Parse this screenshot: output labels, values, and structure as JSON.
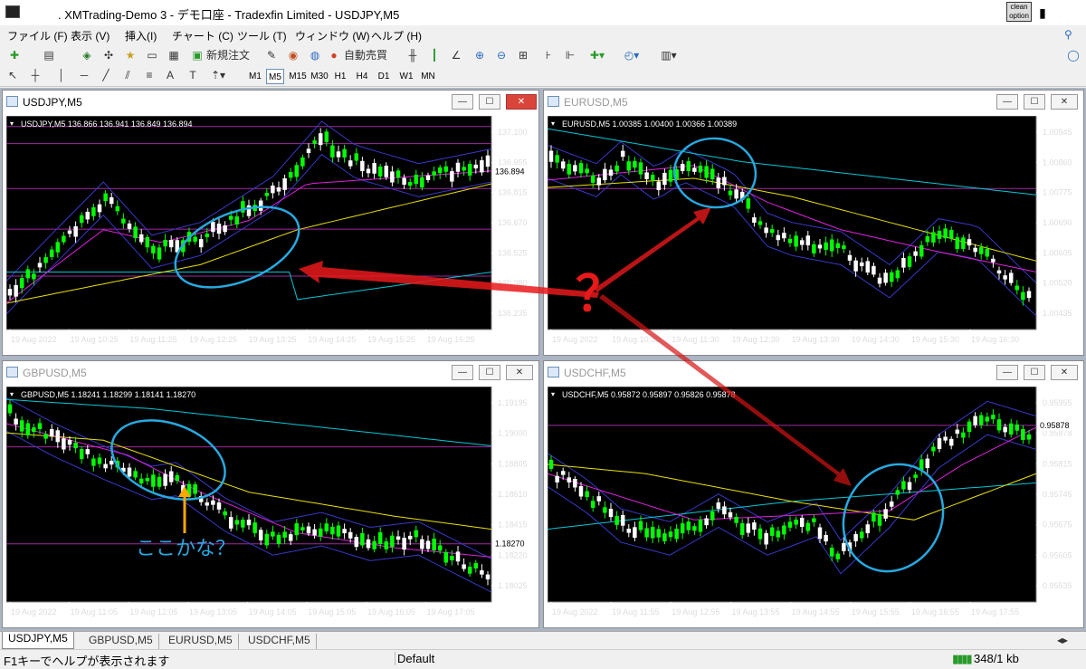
{
  "app": {
    "title": ". XMTrading-Demo 3 - デモ口座 - Tradexfin Limited - USDJPY,M5",
    "clean_top": "clean",
    "clean_bottom": "option"
  },
  "menu": [
    "ファイル (F)",
    "表示 (V)",
    "挿入(I)",
    "チャート (C)",
    "ツール (T)",
    "ウィンドウ (W)",
    "ヘルプ (H)"
  ],
  "toolbar": {
    "new_order": "新規注文",
    "auto_trade": "自動売買"
  },
  "timeframes": [
    "M1",
    "M5",
    "M15",
    "M30",
    "H1",
    "H4",
    "D1",
    "W1",
    "MN"
  ],
  "active_timeframe": "M5",
  "charts": [
    {
      "id": "usdjpy",
      "caption": "USDJPY,M5",
      "info": "USDJPY,M5  136.866 136.941 136.849 136.894",
      "prices": [
        "137.100",
        "136.955",
        "136.815",
        "136.670",
        "136.525",
        "136.380",
        "136.235"
      ],
      "current_price": "136.894",
      "times": [
        "19 Aug 2022",
        "19 Aug 10:25",
        "19 Aug 11:25",
        "19 Aug 12:25",
        "19 Aug 13:25",
        "19 Aug 14:25",
        "19 Aug 15:25",
        "19 Aug 16:25"
      ]
    },
    {
      "id": "eurusd",
      "caption": "EURUSD,M5",
      "info": "EURUSD,M5  1.00385 1.00400 1.00366 1.00389",
      "prices": [
        "1.00945",
        "1.00860",
        "1.00775",
        "1.00690",
        "1.00605",
        "1.00520",
        "1.00435"
      ],
      "current_price": "",
      "times": [
        "19 Aug 2022",
        "19 Aug 10:30",
        "19 Aug 11:30",
        "19 Aug 12:30",
        "19 Aug 13:30",
        "19 Aug 14:30",
        "19 Aug 15:30",
        "19 Aug 16:30"
      ]
    },
    {
      "id": "gbpusd",
      "caption": "GBPUSD,M5",
      "info": "GBPUSD,M5  1.18241 1.18299 1.18141 1.18270",
      "prices": [
        "1.19195",
        "1.19000",
        "1.18805",
        "1.18610",
        "1.18415",
        "1.18220",
        "1.18025"
      ],
      "current_price": "1.18270",
      "times": [
        "19 Aug 2022",
        "19 Aug 11:05",
        "19 Aug 12:05",
        "19 Aug 13:05",
        "19 Aug 14:05",
        "19 Aug 15:05",
        "19 Aug 16:05",
        "19 Aug 17:05"
      ]
    },
    {
      "id": "usdchf",
      "caption": "USDCHF,M5",
      "info": "USDCHF,M5  0.95872 0.95897 0.95826 0.95878",
      "prices": [
        "0.95955",
        "0.95878",
        "0.95815",
        "0.95745",
        "0.95675",
        "0.95605",
        "0.95535"
      ],
      "current_price": "0.95878",
      "times": [
        "19 Aug 2022",
        "19 Aug 11:55",
        "19 Aug 12:55",
        "19 Aug 13:55",
        "19 Aug 14:55",
        "19 Aug 15:55",
        "19 Aug 16:55",
        "19 Aug 17:55"
      ]
    }
  ],
  "annotations": {
    "question": "？",
    "here": "ここかな？"
  },
  "tabs": [
    "USDJPY,M5",
    "GBPUSD,M5",
    "EURUSD,M5",
    "USDCHF,M5"
  ],
  "status": {
    "help": "F1キーでヘルプが表示されます",
    "profile": "Default",
    "traffic": "348/1 kb"
  },
  "colors": {
    "chart_bg": "#000000",
    "bull": "#00ff00",
    "bear": "#ffffff",
    "ma_yellow": "#e8e000",
    "ma_magenta": "#e020e0",
    "ma_cyan": "#00c8d8",
    "band_blue": "#3838c8",
    "highlight": "#27a9e1",
    "arrow": "#e8191b"
  }
}
